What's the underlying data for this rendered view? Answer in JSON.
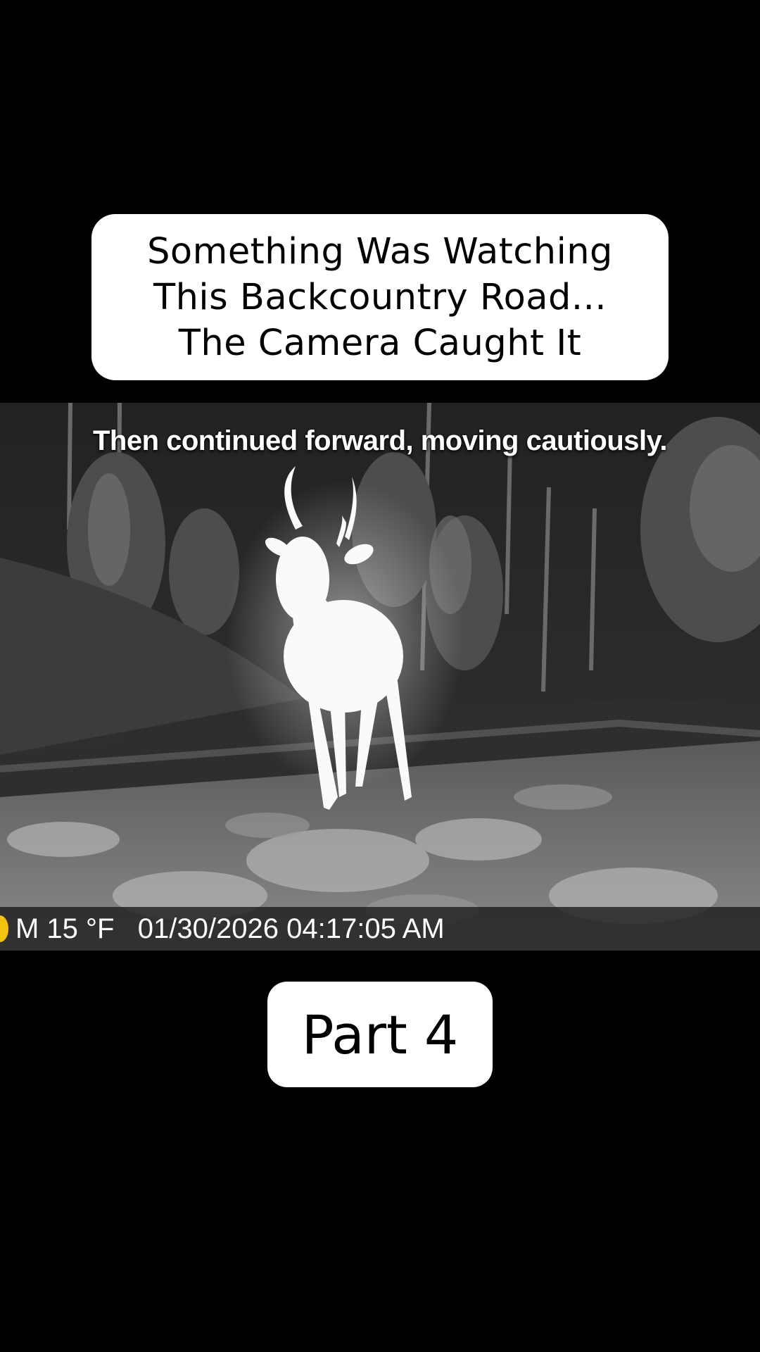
{
  "title_card": {
    "lines": [
      "Something Was Watching",
      "This Backcountry Road...",
      "The Camera Caught It"
    ]
  },
  "video": {
    "caption": "Then continued forward, moving cautiously.",
    "infobar": {
      "icon": "moon-phase-icon",
      "icon_color": "#f2c40f",
      "text": "M 15 °F   01/30/2026 04:17:05 AM"
    }
  },
  "part_label": "Part 4"
}
